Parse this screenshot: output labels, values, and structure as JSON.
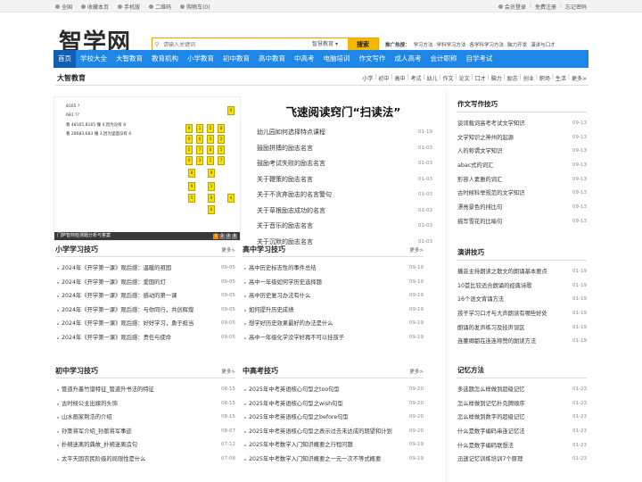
{
  "topbar": {
    "left": [
      "全国",
      "收藏本页",
      "手机版",
      "二维码",
      "购物车(0)"
    ],
    "right": [
      "会员登录",
      "免费注册",
      "忘记密码"
    ]
  },
  "logo": "智学网",
  "search": {
    "placeholder": "请输入关键词",
    "select": "智慧教育",
    "button": "搜索"
  },
  "hot": {
    "label": "推广热搜：",
    "items": [
      "学习方法",
      "学科学习方法",
      "各学科学习方法",
      "脑力开发",
      "演讲与口才"
    ]
  },
  "nav": [
    "首页",
    "学校大全",
    "大智教育",
    "教育机构",
    "小学教育",
    "初中教育",
    "高中教育",
    "中高考",
    "电脑培训",
    "作文写作",
    "成人高考",
    "会计职称",
    "自学考试"
  ],
  "section": {
    "title": "大智教育",
    "links": [
      "小学",
      "初中",
      "高中",
      "考试",
      "幼儿",
      "作文",
      "论文",
      "口才",
      "脑力",
      "励志",
      "创业",
      "职场",
      "生活",
      "更多>"
    ]
  },
  "banner": {
    "caption": "门萨智商检测题分析与答案",
    "dots": [
      "1",
      "2",
      "3",
      "4"
    ],
    "lines": [
      "8165 ?",
      "681 ??",
      "看 48165,8165 懂 4,因为没有 8",
      "看 28683,683 懂 3,因为里面没有 6"
    ],
    "grid": [
      "9",
      "1",
      "5",
      "8",
      "4",
      "6",
      "3",
      "2",
      "5",
      "7",
      "8",
      "5",
      "4",
      "3",
      "1",
      "7",
      "8",
      "9",
      "9"
    ]
  },
  "featured": {
    "title": "飞速阅读窍门“扫读法”",
    "items": [
      {
        "title": "幼儿园如何选择特点课程",
        "date": "01-19"
      },
      {
        "title": "鼓励拼搏的励志名言",
        "date": "01-03"
      },
      {
        "title": "鼓励考试失败的励志名言",
        "date": "01-03"
      },
      {
        "title": "关于鞭策的励志名言",
        "date": "01-03"
      },
      {
        "title": "关于不贪弃励志的名言警句",
        "date": "01-03"
      },
      {
        "title": "关于草根励志成功的名言",
        "date": "01-03"
      },
      {
        "title": "关于音乐的励志名言",
        "date": "01-03"
      },
      {
        "title": "关于沉默的励志名言",
        "date": "01-03"
      }
    ]
  },
  "more": "更多>",
  "columns": [
    {
      "title": "小学学习技巧",
      "items": [
        {
          "title": "2024年《开学第一课》观后感：温暖的祖国",
          "date": "09-05"
        },
        {
          "title": "2024年《开学第一课》观后感：爱国的灯",
          "date": "09-05"
        },
        {
          "title": "2024年《开学第一课》观后感：感动的第一课",
          "date": "09-05"
        },
        {
          "title": "2024年《开学第一课》观后感：与你同行，共创辉煌",
          "date": "09-05"
        },
        {
          "title": "2024年《开学第一课》观后感：好好学习，勇于担当",
          "date": "09-05"
        },
        {
          "title": "2024年《开学第一课》观后感：责任与使命",
          "date": "09-05"
        }
      ]
    },
    {
      "title": "高中学习技巧",
      "items": [
        {
          "title": "高中历史标志性的事件总结",
          "date": "09-19"
        },
        {
          "title": "高中一年级如何学历史选择题",
          "date": "09-19"
        },
        {
          "title": "高中历史复习办法有什么",
          "date": "09-19"
        },
        {
          "title": "如何提升历史成绩",
          "date": "09-19"
        },
        {
          "title": "想学好历史效果最好的办法是什么",
          "date": "09-19"
        },
        {
          "title": "高中一年级化学没学好再不可以挂孩子",
          "date": "09-19"
        }
      ]
    },
    {
      "title": "初中学习技巧",
      "items": [
        {
          "title": "管道升墨竹谱特征_管道升书法的特征",
          "date": "08-15"
        },
        {
          "title": "古时候公主出嫁的头饰",
          "date": "08-15"
        },
        {
          "title": "山水画家荆浩的介绍",
          "date": "08-15"
        },
        {
          "title": "孙策将军介绍_孙膑将军事迹",
          "date": "08-07"
        },
        {
          "title": "扑朔迷离的典故_扑朔迷离造句",
          "date": "07-12"
        },
        {
          "title": "太平天国农民阶级的局限性是什么",
          "date": "07-08"
        }
      ]
    },
    {
      "title": "中高考技巧",
      "items": [
        {
          "title": "2025年中考英语核心句型之too句型",
          "date": "09-20"
        },
        {
          "title": "2025年中考英语核心句型之wish句型",
          "date": "09-20"
        },
        {
          "title": "2025年中考英语核心句型之before句型",
          "date": "09-20"
        },
        {
          "title": "2025年中考英语核心句型之表示过去未达成的期望和计划",
          "date": "09-20"
        },
        {
          "title": "2025年中考数学入门知识概要之行程问题",
          "date": "09-19"
        },
        {
          "title": "2025年中考数学入门知识概要之一元一次不等式概要",
          "date": "09-19"
        }
      ]
    }
  ],
  "sidebar": [
    {
      "title": "作文写作技巧",
      "items": [
        {
          "title": "谈词载词高考考试文学知识",
          "date": "09-13"
        },
        {
          "title": "文学知识之神州的起源",
          "date": "09-13"
        },
        {
          "title": "人的称谓文学知识",
          "date": "09-13"
        },
        {
          "title": "abac式的词汇",
          "date": "09-13"
        },
        {
          "title": "形容人素雅的词汇",
          "date": "09-13"
        },
        {
          "title": "古时候科举规范的文学知识",
          "date": "09-13"
        },
        {
          "title": "漂亮景色的排比句",
          "date": "09-13"
        },
        {
          "title": "描写雪花的比喻句",
          "date": "09-13"
        }
      ]
    },
    {
      "title": "演讲技巧",
      "items": [
        {
          "title": "播音主持朗读之散文的朗诵基本要点",
          "date": "01-19"
        },
        {
          "title": "10首比较适合朗诵的经典诗歌",
          "date": "01-19"
        },
        {
          "title": "16个语文背诵方法",
          "date": "01-19"
        },
        {
          "title": "孩子学习口才与大声朗读有哪些好处",
          "date": "01-19"
        },
        {
          "title": "朗诵的发声练习及技声误区",
          "date": "01-19"
        },
        {
          "title": "连董卿都在连连称赞的朗读方法",
          "date": "01-19"
        }
      ]
    },
    {
      "title": "记忆方法",
      "items": [
        {
          "title": "多选题怎么样做到超级记忆",
          "date": "01-23"
        },
        {
          "title": "怎么样做到记忆扑克牌顺序",
          "date": "01-23"
        },
        {
          "title": "怎么样做到数字的超级记忆",
          "date": "01-23"
        },
        {
          "title": "什么是数字编码串连记忆法",
          "date": "01-23"
        },
        {
          "title": "什么是数字编码联想法",
          "date": "01-23"
        },
        {
          "title": "迅速记忆训练培训7个原理",
          "date": "01-23"
        }
      ]
    }
  ]
}
